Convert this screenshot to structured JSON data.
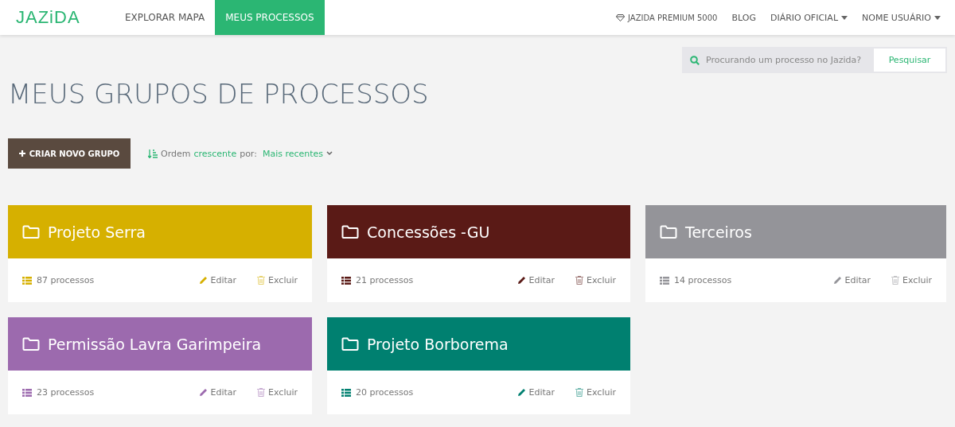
{
  "logo": "JAZiDA",
  "nav": [
    {
      "label": "EXPLORAR MAPA",
      "selected": false
    },
    {
      "label": "MEUS PROCESSOS",
      "selected": true
    }
  ],
  "top_links": [
    {
      "kind": "premium",
      "label": "JAZIDA PREMIUM 5000"
    },
    {
      "kind": "link",
      "label": "BLOG"
    },
    {
      "kind": "dropdown",
      "label": "DIÁRIO OFICIAL"
    },
    {
      "kind": "dropdown",
      "label": "NOME USUÁRIO"
    }
  ],
  "search": {
    "placeholder": "Procurando um processo no Jazida?",
    "button": "Pesquisar"
  },
  "page_title": "MEUS GRUPOS DE PROCESSOS",
  "create_button": "CRIAR NOVO GRUPO",
  "sort": {
    "prefix": "Ordem",
    "direction": "crescente",
    "by": "por:",
    "value": "Mais recentes"
  },
  "groups": [
    {
      "name": "Projeto Serra",
      "color": "#d6b000",
      "count": "87 processos",
      "edit": "Editar",
      "delete": "Excluir"
    },
    {
      "name": "Concessões -GU",
      "color": "#5a1a16",
      "count": "21 processos",
      "edit": "Editar",
      "delete": "Excluir"
    },
    {
      "name": "Terceiros",
      "color": "#949499",
      "count": "14 processos",
      "edit": "Editar",
      "delete": "Excluir"
    },
    {
      "name": "Permissão Lavra Garimpeira",
      "color": "#9c6aae",
      "count": "23 processos",
      "edit": "Editar",
      "delete": "Excluir"
    },
    {
      "name": "Projeto Borborema",
      "color": "#008070",
      "count": "20 processos",
      "edit": "Editar",
      "delete": "Excluir"
    }
  ]
}
